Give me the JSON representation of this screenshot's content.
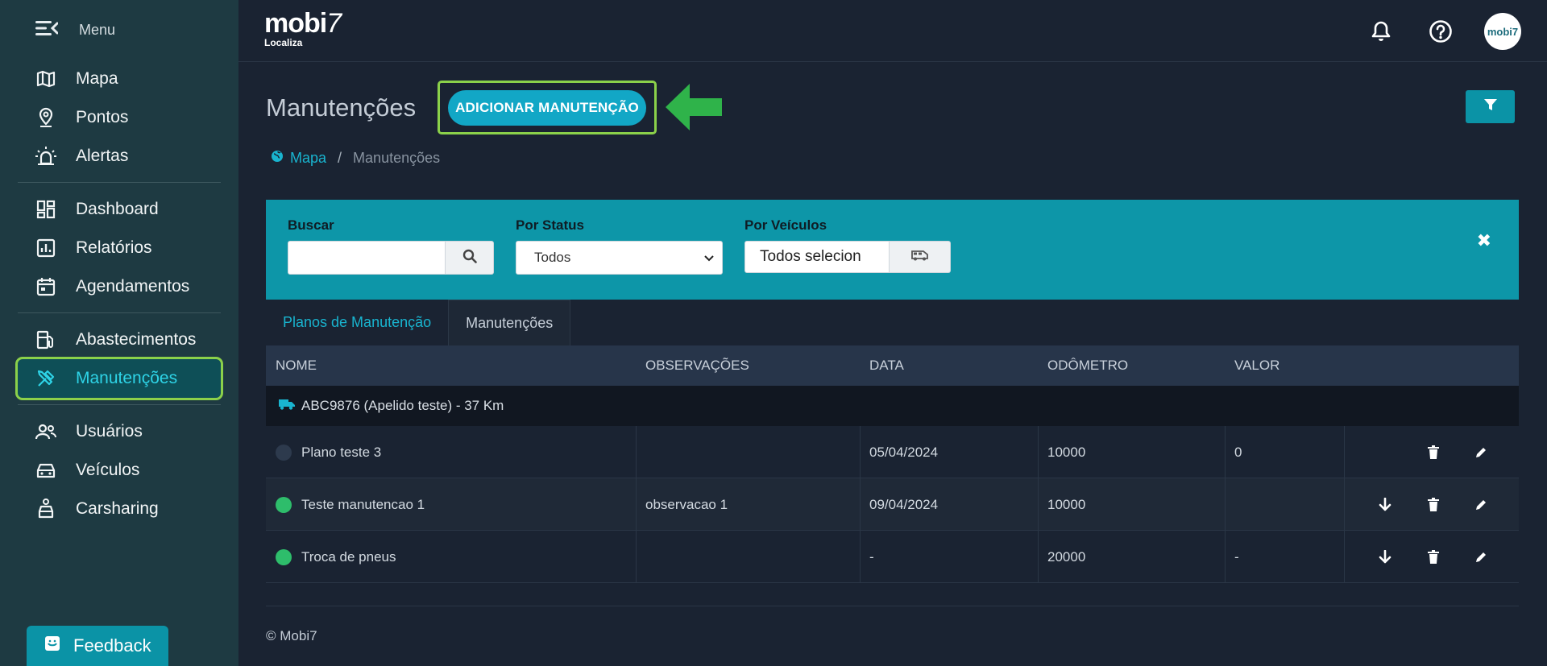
{
  "sidebar": {
    "menu_label": "Menu",
    "items": [
      {
        "label": "Mapa",
        "icon": "map-icon"
      },
      {
        "label": "Pontos",
        "icon": "location-pin-icon"
      },
      {
        "label": "Alertas",
        "icon": "alarm-light-icon"
      },
      {
        "label": "Dashboard",
        "icon": "dashboard-icon"
      },
      {
        "label": "Relatórios",
        "icon": "bar-chart-icon"
      },
      {
        "label": "Agendamentos",
        "icon": "calendar-icon"
      },
      {
        "label": "Abastecimentos",
        "icon": "fuel-pump-icon"
      },
      {
        "label": "Manutenções",
        "icon": "tools-icon",
        "active": true
      },
      {
        "label": "Usuários",
        "icon": "users-icon"
      },
      {
        "label": "Veículos",
        "icon": "car-icon"
      },
      {
        "label": "Carsharing",
        "icon": "carsharing-icon"
      }
    ],
    "feedback_label": "Feedback"
  },
  "topbar": {
    "logo_word": "mobi",
    "logo_seven": "7",
    "logo_sub": "Localiza",
    "avatar_text": "mobi7"
  },
  "page": {
    "title": "Manutenções",
    "add_button": "ADICIONAR MANUTENÇÃO"
  },
  "breadcrumb": {
    "home": "Mapa",
    "separator": "/",
    "current": "Manutenções"
  },
  "filters": {
    "search_label": "Buscar",
    "search_value": "",
    "status_label": "Por Status",
    "status_value": "Todos",
    "vehicles_label": "Por Veículos",
    "vehicles_value": "Todos selecion"
  },
  "tabs": [
    {
      "label": "Planos de Manutenção",
      "selected": false
    },
    {
      "label": "Manutenções",
      "selected": true
    }
  ],
  "table": {
    "columns": [
      "NOME",
      "OBSERVAÇÕES",
      "DATA",
      "ODÔMETRO",
      "VALOR"
    ],
    "group": "ABC9876 (Apelido teste) - 37 Km",
    "rows": [
      {
        "status_color": "#2d3a4d",
        "name": "Plano teste 3",
        "obs": "",
        "date": "05/04/2024",
        "odometer": "10000",
        "value": "0",
        "download": false
      },
      {
        "status_color": "#2ebd6b",
        "name": "Teste manutencao 1",
        "obs": "observacao 1",
        "date": "09/04/2024",
        "odometer": "10000",
        "value": "",
        "download": true
      },
      {
        "status_color": "#2ebd6b",
        "name": "Troca de pneus",
        "obs": "",
        "date": "-",
        "odometer": "20000",
        "value": "-",
        "download": true
      }
    ]
  },
  "footer": "© Mobi7",
  "colors": {
    "accent": "#0d96a8",
    "highlight": "#8bd14a",
    "arrow": "#2fb34a"
  }
}
